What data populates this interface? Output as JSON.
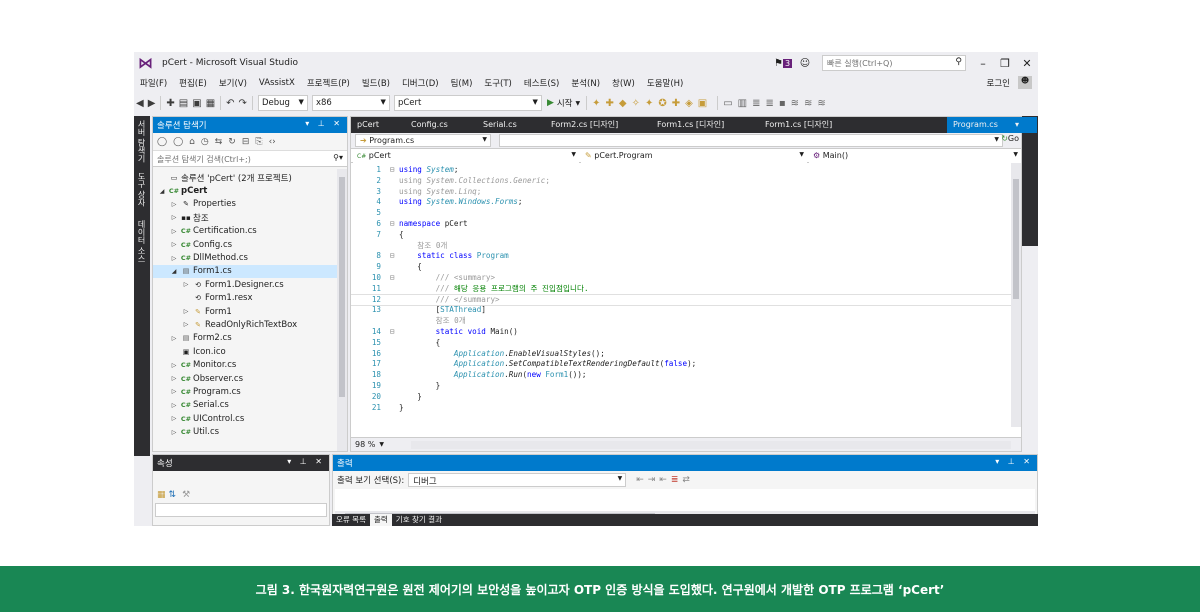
{
  "window": {
    "title": "pCert - Microsoft Visual Studio",
    "notification_count": "3",
    "quick_launch_placeholder": "빠른 실행(Ctrl+Q)",
    "login": "로그인"
  },
  "menu": [
    "파일(F)",
    "편집(E)",
    "보기(V)",
    "VAssistX",
    "프로젝트(P)",
    "빌드(B)",
    "디버그(D)",
    "팀(M)",
    "도구(T)",
    "테스트(S)",
    "분석(N)",
    "창(W)",
    "도움말(H)"
  ],
  "toolbar": {
    "config": "Debug",
    "platform": "x86",
    "startup_project": "pCert",
    "start_label": "시작"
  },
  "left_side_tabs": [
    "서버 탐색기",
    "도구 상자",
    "데이터 소스"
  ],
  "solution_explorer": {
    "title": "솔루션 탐색기",
    "search_placeholder": "솔루션 탐색기 검색(Ctrl+;)",
    "items": [
      {
        "label": "솔루션 'pCert' (2개 프로젝트)",
        "level": 0,
        "icon": "solution-icon",
        "exp": ""
      },
      {
        "label": "pCert",
        "level": 0,
        "icon": "csproj-icon",
        "exp": "◢",
        "bold": true
      },
      {
        "label": "Properties",
        "level": 1,
        "icon": "wrench-icon",
        "exp": "▷"
      },
      {
        "label": "참조",
        "level": 1,
        "icon": "references-icon",
        "exp": "▷"
      },
      {
        "label": "Certification.cs",
        "level": 1,
        "icon": "cs-file-icon",
        "exp": "▷"
      },
      {
        "label": "Config.cs",
        "level": 1,
        "icon": "cs-file-icon",
        "exp": "▷"
      },
      {
        "label": "DllMethod.cs",
        "level": 1,
        "icon": "cs-file-icon",
        "exp": "▷"
      },
      {
        "label": "Form1.cs",
        "level": 1,
        "icon": "form-icon",
        "exp": "◢",
        "selected": true
      },
      {
        "label": "Form1.Designer.cs",
        "level": 2,
        "icon": "designer-icon",
        "exp": "▷"
      },
      {
        "label": "Form1.resx",
        "level": 2,
        "icon": "resx-icon",
        "exp": ""
      },
      {
        "label": "Form1",
        "level": 2,
        "icon": "class-icon",
        "exp": "▷"
      },
      {
        "label": "ReadOnlyRichTextBox",
        "level": 2,
        "icon": "class-icon",
        "exp": "▷"
      },
      {
        "label": "Form2.cs",
        "level": 1,
        "icon": "form-icon",
        "exp": "▷"
      },
      {
        "label": "Icon.ico",
        "level": 1,
        "icon": "ico-file-icon",
        "exp": ""
      },
      {
        "label": "Monitor.cs",
        "level": 1,
        "icon": "cs-file-icon",
        "exp": "▷"
      },
      {
        "label": "Observer.cs",
        "level": 1,
        "icon": "cs-file-icon",
        "exp": "▷"
      },
      {
        "label": "Program.cs",
        "level": 1,
        "icon": "cs-file-icon",
        "exp": "▷"
      },
      {
        "label": "Serial.cs",
        "level": 1,
        "icon": "cs-file-icon",
        "exp": "▷"
      },
      {
        "label": "UIControl.cs",
        "level": 1,
        "icon": "cs-file-icon",
        "exp": "▷"
      },
      {
        "label": "Util.cs",
        "level": 1,
        "icon": "cs-file-icon",
        "exp": "▷"
      }
    ]
  },
  "editor": {
    "tabs": [
      "pCert",
      "Config.cs",
      "Serial.cs",
      "Form2.cs [디자인]",
      "Form1.cs [디자인]",
      "Form1.cs [디자인]",
      "Program.cs"
    ],
    "active_tab": "Program.cs",
    "file_combo": "Program.cs",
    "project_combo": "pCert",
    "class_combo": "pCert.Program",
    "member_combo": "Main()",
    "go_label": "Go",
    "zoom": "98 %",
    "lines": [
      {
        "n": "1",
        "fold": "⊟",
        "html": "<span class='kw'>using</span> <span class='ty'><i>System</i></span>;"
      },
      {
        "n": "2",
        "fold": "",
        "html": "<span class='gray'>using <i>System.Collections.Generic</i>;</span>"
      },
      {
        "n": "3",
        "fold": "",
        "html": "<span class='gray'>using <i>System.Linq</i>;</span>"
      },
      {
        "n": "4",
        "fold": "",
        "html": "<span class='kw'>using</span> <i class='ty'>System.Windows.Forms</i>;"
      },
      {
        "n": "5",
        "fold": "",
        "html": ""
      },
      {
        "n": "6",
        "fold": "⊟",
        "html": "<span class='kw'>namespace</span> pCert"
      },
      {
        "n": "7",
        "fold": "",
        "html": "{"
      },
      {
        "n": "",
        "fold": "",
        "html": "    <span class='refs'>참조 0개</span>"
      },
      {
        "n": "8",
        "fold": "⊟",
        "html": "    <span class='kw'>static class</span> <span class='ty'>Program</span>"
      },
      {
        "n": "9",
        "fold": "",
        "html": "    {"
      },
      {
        "n": "10",
        "fold": "⊟",
        "html": "        <span class='gray'>/// &lt;summary&gt;</span>"
      },
      {
        "n": "11",
        "fold": "",
        "html": "        <span class='gray'>/// </span><span class='cm'>해당 응용 프로그램의 주 진입점입니다.</span>"
      },
      {
        "n": "12",
        "fold": "",
        "html": "        <span class='gray'>/// &lt;/summary&gt;</span>",
        "hl": true
      },
      {
        "n": "13",
        "fold": "",
        "html": "        [<span class='ty'>STAThread</span>]"
      },
      {
        "n": "",
        "fold": "",
        "html": "        <span class='refs'>참조 0개</span>"
      },
      {
        "n": "14",
        "fold": "⊟",
        "html": "        <span class='kw'>static void</span> Main()"
      },
      {
        "n": "15",
        "fold": "",
        "html": "        {"
      },
      {
        "n": "16",
        "fold": "",
        "html": "            <i class='ty'>Application</i>.<i>EnableVisualStyles</i>();"
      },
      {
        "n": "17",
        "fold": "",
        "html": "            <i class='ty'>Application</i>.<i>SetCompatibleTextRenderingDefault</i>(<span class='kw'>false</span>);"
      },
      {
        "n": "18",
        "fold": "",
        "html": "            <i class='ty'>Application</i>.<i>Run</i>(<span class='kw'>new</span> <span class='ty'>Form1</span>());"
      },
      {
        "n": "19",
        "fold": "",
        "html": "        }"
      },
      {
        "n": "20",
        "fold": "",
        "html": "    }"
      },
      {
        "n": "21",
        "fold": "",
        "html": "}"
      }
    ]
  },
  "properties": {
    "title": "속성"
  },
  "output": {
    "title": "출력",
    "show_label": "출력 보기 선택(S):",
    "source": "디버그",
    "bottom_tabs": [
      "오류 목록",
      "출력",
      "기호 찾기 결과"
    ],
    "active_bottom_tab": "출력"
  },
  "caption": "그림 3. 한국원자력연구원은 원전 제어기의 보안성을 높이고자 OTP 인증 방식을 도입했다. 연구원에서 개발한 OTP 프로그램 ‘pCert’"
}
